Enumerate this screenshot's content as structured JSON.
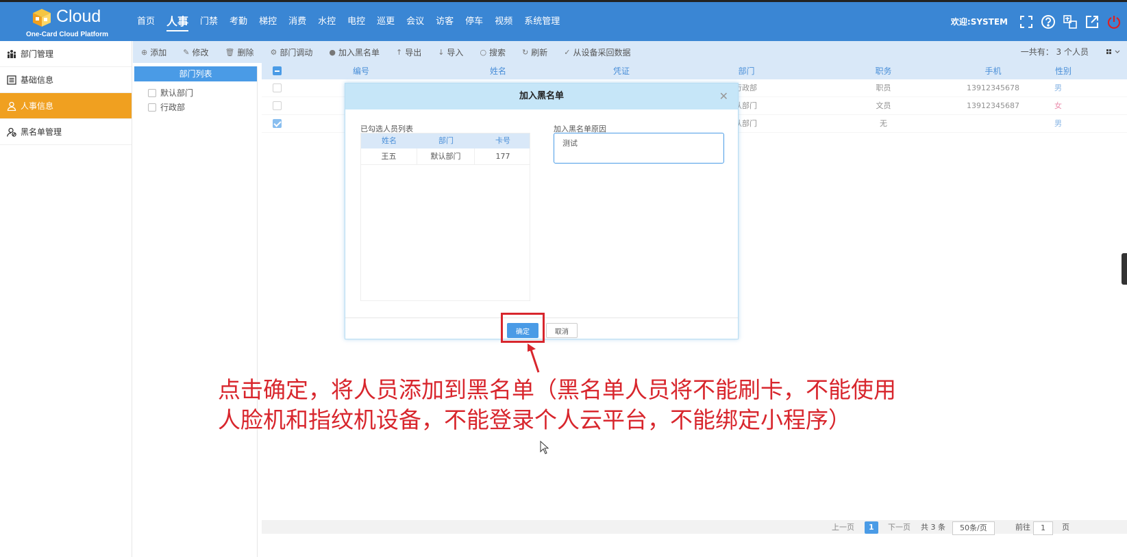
{
  "header": {
    "logo_text": "Cloud",
    "logo_sub": "One-Card Cloud Platform",
    "nav": [
      "首页",
      "人事",
      "门禁",
      "考勤",
      "梯控",
      "消费",
      "水控",
      "电控",
      "巡更",
      "会议",
      "访客",
      "停车",
      "视频",
      "系统管理"
    ],
    "active_nav": "人事",
    "welcome": "欢迎:SYSTEM",
    "icons": [
      "fullscreen-icon",
      "help-icon",
      "translate-icon",
      "external-link-icon",
      "power-icon"
    ]
  },
  "sidebar": {
    "items": [
      {
        "label": "部门管理",
        "icon": "org-icon",
        "active": false
      },
      {
        "label": "基础信息",
        "icon": "list-icon",
        "active": false
      },
      {
        "label": "人事信息",
        "icon": "user-icon",
        "active": true
      },
      {
        "label": "黑名单管理",
        "icon": "user-block-icon",
        "active": false
      }
    ]
  },
  "toolbar": {
    "items": [
      {
        "label": "添加",
        "icon": "⊕"
      },
      {
        "label": "修改",
        "icon": "✎"
      },
      {
        "label": "删除",
        "icon": "🗑"
      },
      {
        "label": "部门调动",
        "icon": "⚙"
      },
      {
        "label": "加入黑名单",
        "icon": "●"
      },
      {
        "label": "导出",
        "icon": "↑"
      },
      {
        "label": "导入",
        "icon": "↓"
      },
      {
        "label": "搜索",
        "icon": "○"
      },
      {
        "label": "刷新",
        "icon": "↻"
      },
      {
        "label": "从设备采回数据",
        "icon": "✓"
      }
    ],
    "total": "一共有： 3 个人员"
  },
  "dept_panel": {
    "title": "部门列表",
    "items": [
      "默认部门",
      "行政部"
    ]
  },
  "table": {
    "headers": [
      "编号",
      "姓名",
      "凭证",
      "部门",
      "职务",
      "手机",
      "性别"
    ],
    "rows": [
      {
        "dept": "行政部",
        "title": "职员",
        "phone": "13912345678",
        "gender": "男",
        "checked": false
      },
      {
        "dept": "认部门",
        "title": "文员",
        "phone": "13912345687",
        "gender": "女",
        "checked": false
      },
      {
        "dept": "认部门",
        "title": "无",
        "phone": "",
        "gender": "男",
        "checked": true
      }
    ]
  },
  "modal": {
    "title": "加入黑名单",
    "selected_label": "已勾选人员列表",
    "selected_headers": [
      "姓名",
      "部门",
      "卡号"
    ],
    "selected_rows": [
      {
        "name": "王五",
        "dept": "默认部门",
        "card": "177"
      }
    ],
    "reason_label": "加入黑名单原因",
    "reason_value": "测试",
    "ok_label": "确定",
    "cancel_label": "取消"
  },
  "annotation": {
    "line1": "点击确定，将人员添加到黑名单（黑名单人员将不能刷卡，不能使用",
    "line2": "人脸机和指纹机设备，不能登录个人云平台，不能绑定小程序）",
    "color": "#d8262d"
  },
  "pager": {
    "prev": "上一页",
    "current": "1",
    "next": "下一页",
    "total": "共 3 条",
    "page_size": "50条/页",
    "goto_label": "前往",
    "goto_value": "1",
    "page_unit": "页"
  }
}
